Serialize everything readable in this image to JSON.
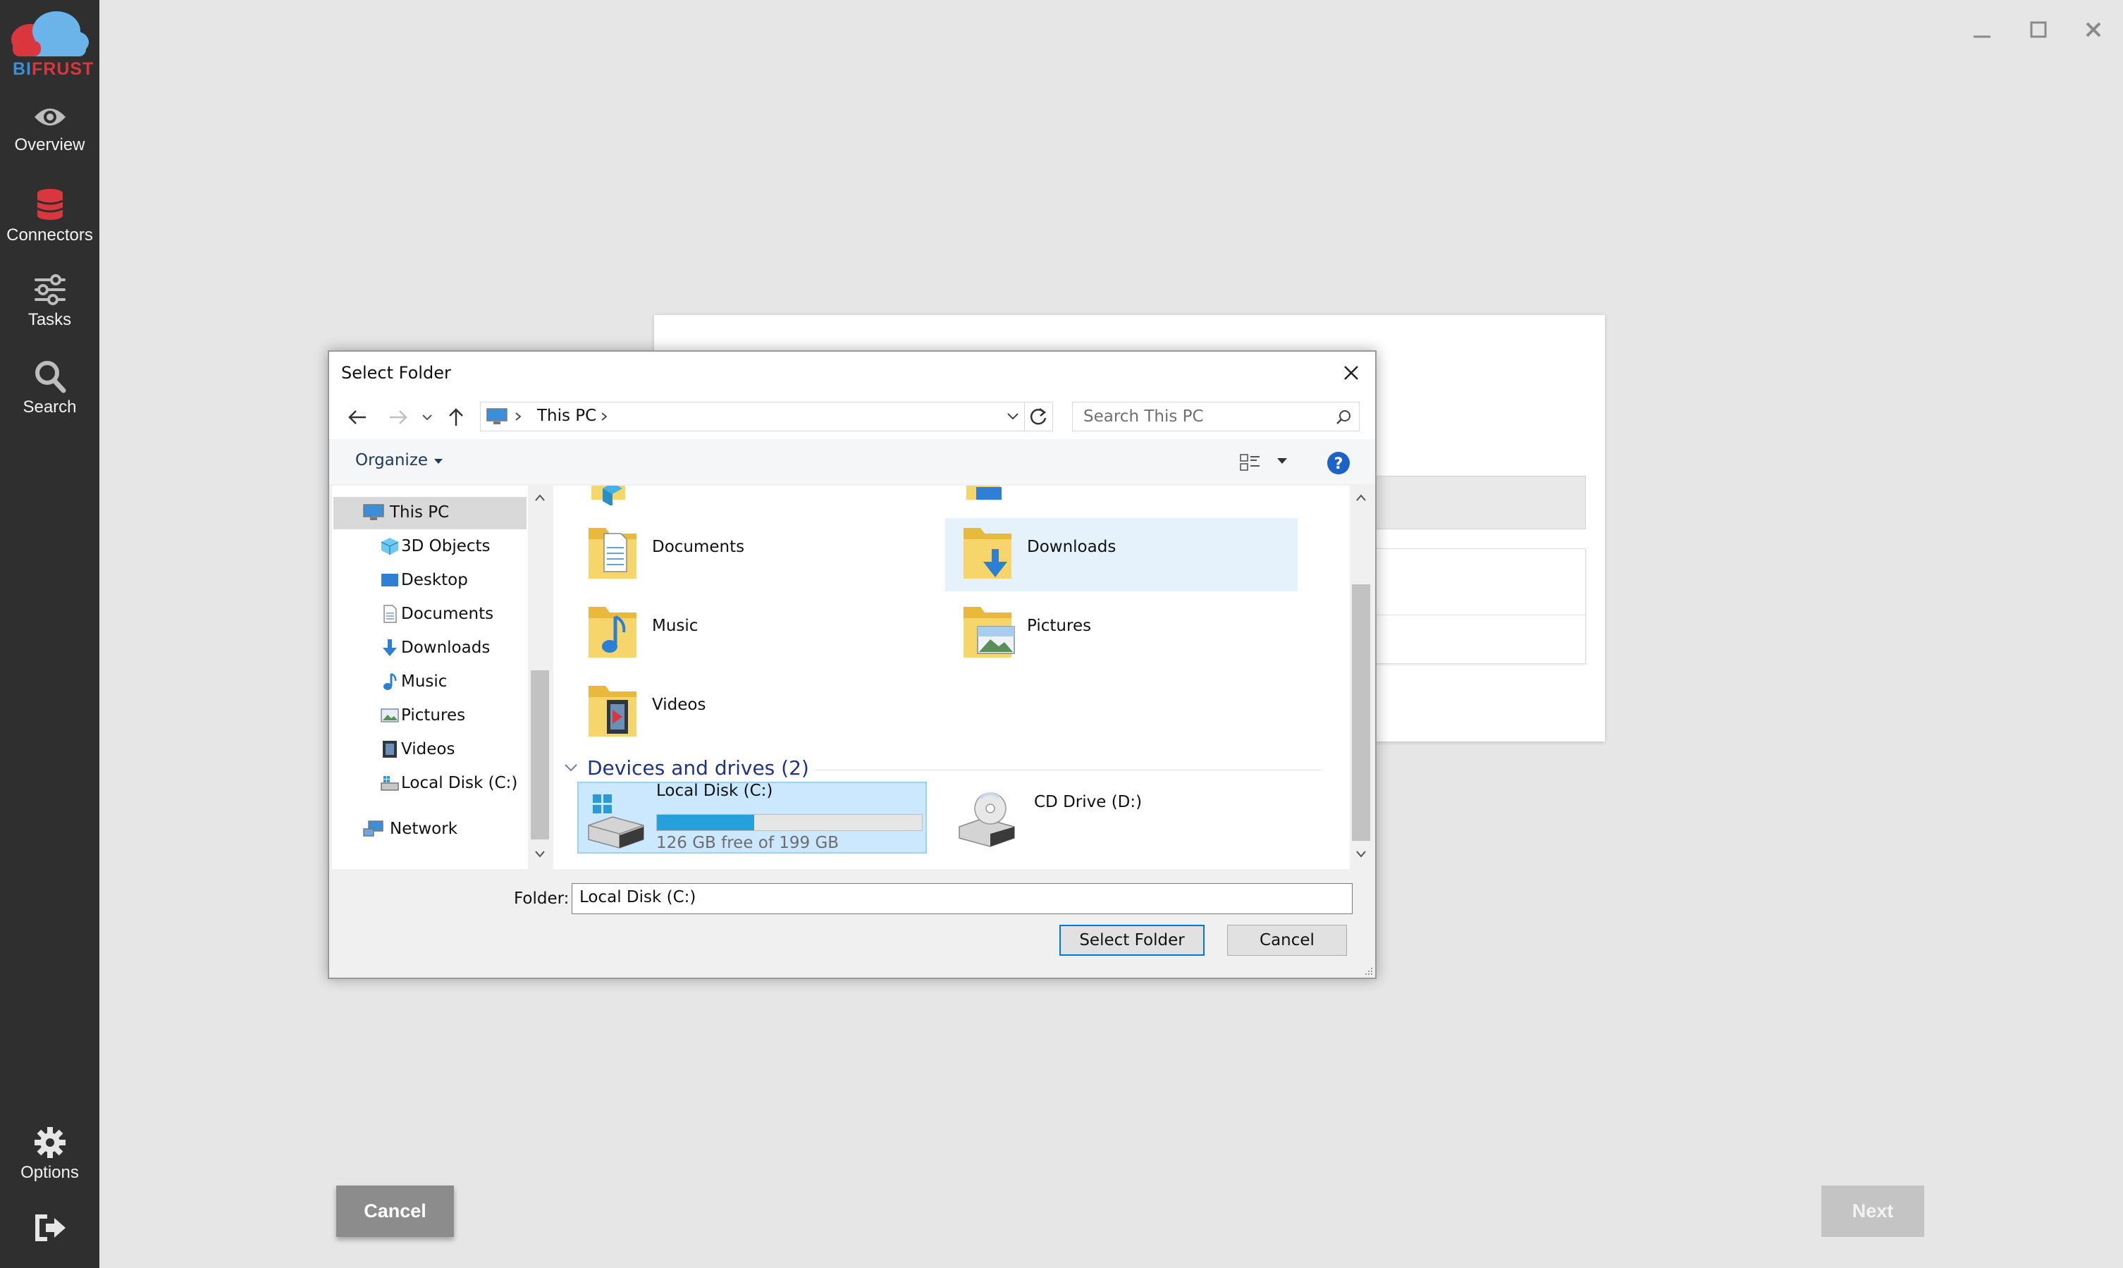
{
  "app": {
    "logo_text_bi": "BI",
    "logo_text_rest": "FRUST",
    "accent_red": "#d9363e",
    "accent_blue": "#3a8fd6",
    "sidebar": {
      "items": [
        {
          "label": "Overview",
          "icon": "eye-icon"
        },
        {
          "label": "Connectors",
          "icon": "database-icon"
        },
        {
          "label": "Tasks",
          "icon": "sliders-icon"
        },
        {
          "label": "Search",
          "icon": "search-icon"
        }
      ],
      "bottom": [
        {
          "label": "Options",
          "icon": "gear-icon"
        },
        {
          "label": "",
          "icon": "logout-icon"
        }
      ]
    },
    "footer": {
      "cancel_label": "Cancel",
      "next_label": "Next"
    }
  },
  "dialog": {
    "title": "Select Folder",
    "breadcrumb": {
      "location": "This PC"
    },
    "search": {
      "placeholder": "Search This PC"
    },
    "toolbar": {
      "organize_label": "Organize"
    },
    "nav_tree": [
      {
        "label": "This PC",
        "icon": "computer-icon"
      },
      {
        "label": "3D Objects",
        "icon": "cube-icon"
      },
      {
        "label": "Desktop",
        "icon": "desktop-icon"
      },
      {
        "label": "Documents",
        "icon": "document-icon"
      },
      {
        "label": "Downloads",
        "icon": "download-icon"
      },
      {
        "label": "Music",
        "icon": "music-icon"
      },
      {
        "label": "Pictures",
        "icon": "picture-icon"
      },
      {
        "label": "Videos",
        "icon": "film-icon"
      },
      {
        "label": "Local Disk (C:)",
        "icon": "drive-icon"
      },
      {
        "label": "Network",
        "icon": "network-icon"
      }
    ],
    "folders": [
      {
        "label": "Documents",
        "icon": "documents-folder-icon"
      },
      {
        "label": "Downloads",
        "icon": "downloads-folder-icon"
      },
      {
        "label": "Music",
        "icon": "music-folder-icon"
      },
      {
        "label": "Pictures",
        "icon": "pictures-folder-icon"
      },
      {
        "label": "Videos",
        "icon": "videos-folder-icon"
      }
    ],
    "devices_group": {
      "label": "Devices and drives (2)"
    },
    "drives": [
      {
        "label": "Local Disk (C:)",
        "free_text": "126 GB free of 199 GB",
        "used_fraction": 0.367,
        "icon": "hard-drive-icon"
      },
      {
        "label": "CD Drive (D:)",
        "icon": "cd-drive-icon"
      }
    ],
    "folder_field": {
      "label": "Folder:",
      "value": "Local Disk (C:)"
    },
    "buttons": {
      "select_label": "Select Folder",
      "cancel_label": "Cancel"
    }
  }
}
